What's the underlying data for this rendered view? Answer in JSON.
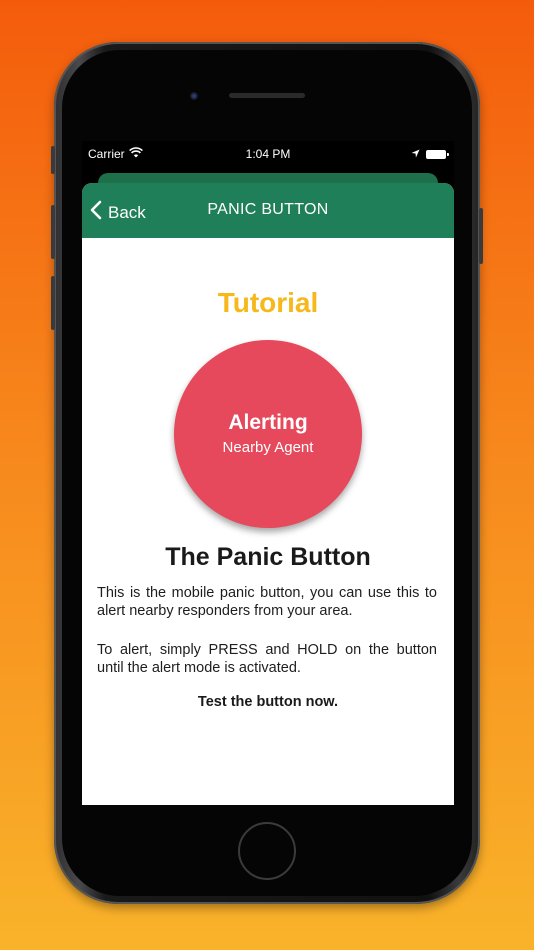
{
  "statusbar": {
    "carrier": "Carrier",
    "time": "1:04 PM",
    "wifi_icon": "wifi-icon",
    "location_icon": "location-arrow-icon",
    "battery_icon": "battery-icon"
  },
  "navbar": {
    "back_label": "Back",
    "title": "PANIC BUTTON",
    "color": "#1f7f58"
  },
  "content": {
    "tutorial_title": "Tutorial",
    "panic_button": {
      "main_label": "Alerting",
      "sub_label": "Nearby Agent",
      "color": "#e5495b"
    },
    "heading": "The Panic Button",
    "paragraph_1": "This is the mobile panic button, you can use this to alert nearby responders from your area.",
    "paragraph_2": "To alert, simply PRESS and HOLD on the button until the alert mode is activated.",
    "call_to_action": "Test the button now."
  },
  "colors": {
    "accent_yellow": "#f6b81b",
    "background_top": "#f45c0c",
    "background_bottom": "#f9b32a"
  }
}
